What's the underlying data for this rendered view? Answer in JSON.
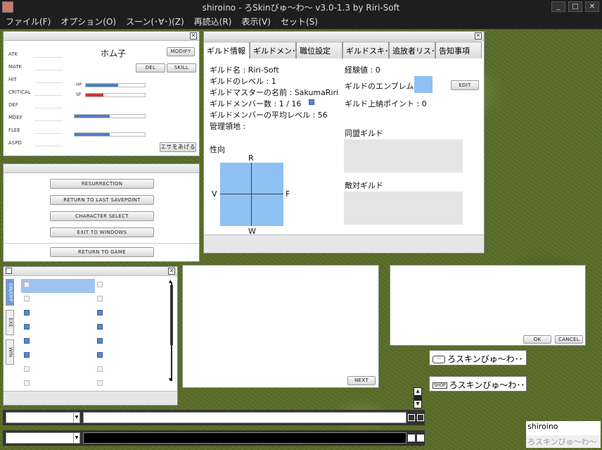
{
  "titlebar": {
    "title": "shiroino - ろSkinびゅ～わ～ v3.0-1.3 by Riri-Soft"
  },
  "menu": [
    "ファイル(F)",
    "オプション(O)",
    "スーン(･∀･)(Z)",
    "再読込(R)",
    "表示(V)",
    "セット(S)"
  ],
  "status": {
    "char_name": "ホム子",
    "modify": "MODIFY",
    "del": "DEL",
    "skill": "SKILL",
    "feed": "エサをあげる",
    "stats": [
      "ATK",
      "MATK",
      "HIT",
      "CRITICAL",
      "DEF",
      "MDEF",
      "FLEE",
      "ASPD"
    ],
    "hp_label": "HP",
    "sp_label": "SP",
    "hp_fill": 0.55,
    "sp_fill": 0.3,
    "bar3_fill": 0.5,
    "bar4_fill": 0.5,
    "hp_color": "#4f7dc4",
    "sp_color": "#cc3333"
  },
  "escape_menu": {
    "resurrection": "RESURRECTION",
    "savepoint": "RETURN TO LAST SAVEPOINT",
    "charselect": "CHARACTER SELECT",
    "exit": "EXIT TO WINDOWS",
    "game": "RETURN TO GAME"
  },
  "guild": {
    "tabs": [
      "ギルド情報",
      "ギルドメン･･",
      "職位設定",
      "ギルドスキ･･",
      "追放者リス･･",
      "告知事項"
    ],
    "name": "ギルド名 : Riri-Soft",
    "level": "ギルドのレベル : 1",
    "master": "ギルドマスターの名前 : SakumaRiri",
    "members": "ギルドメンバー数 : 1 / 16",
    "avg_level": "ギルドメンバーの平均レベル : 56",
    "territory": "管理領地 :",
    "exp": "経験値 : 0",
    "emblem": "ギルドのエンブレム",
    "edit": "EDIT",
    "tax": "ギルド上納ポイント : 0",
    "alliance": "同盟ギルド",
    "enemy": "敵対ギルド",
    "tendency": "性向",
    "axis_r": "R",
    "axis_v": "V",
    "axis_f": "F",
    "axis_w": "W",
    "emblem_color": "#8fc0f4",
    "chart_color": "#8fc0f4"
  },
  "skillbar": {
    "tabs": [
      "ON/OFF",
      "EXE",
      "WIN"
    ]
  },
  "npc": {
    "next": "NEXT"
  },
  "dialog": {
    "ok": "OK",
    "cancel": "CANCEL"
  },
  "bubbles": {
    "chat": "ろスキンびゅ～わ･･",
    "shop_tag": "SHOP",
    "shop": "ろスキンびゅ～わ･･"
  },
  "player": {
    "name": "shiroino",
    "title": "ろスキンびゅ～わ～"
  }
}
